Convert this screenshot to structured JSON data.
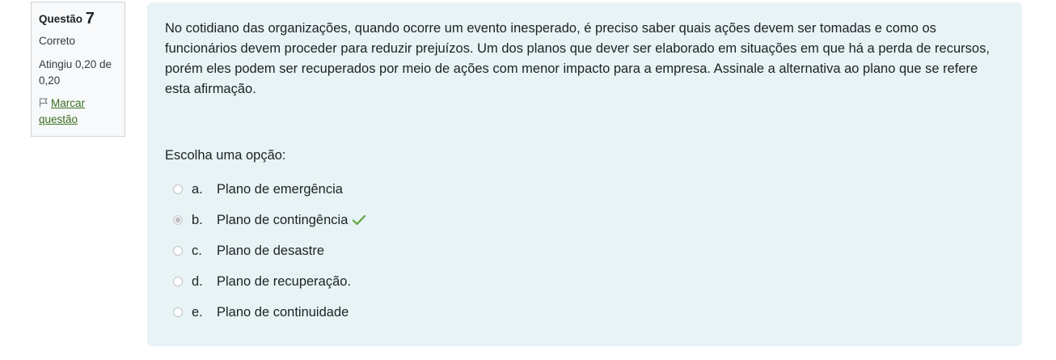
{
  "info": {
    "question_label": "Questão",
    "question_number": "7",
    "state": "Correto",
    "grade": "Atingiu 0,20 de 0,20",
    "flag_label": "Marcar questão"
  },
  "question": {
    "text": "No cotidiano das organizações, quando ocorre um evento inesperado, é preciso saber quais ações devem ser tomadas e como os funcionários devem proceder para reduzir prejuízos. Um dos planos que dever ser elaborado em situações em que há a perda de recursos, porém eles podem ser recuperados por meio de ações com menor impacto para a empresa. Assinale a alternativa ao plano que se refere esta afirmação.",
    "prompt": "Escolha uma opção:",
    "answers": [
      {
        "letter": "a.",
        "label": "Plano de emergência"
      },
      {
        "letter": "b.",
        "label": "Plano de contingência"
      },
      {
        "letter": "c.",
        "label": "Plano de desastre"
      },
      {
        "letter": "d.",
        "label": "Plano de recuperação."
      },
      {
        "letter": "e.",
        "label": "Plano de continuidade"
      }
    ],
    "selected_index": 1
  },
  "colors": {
    "content_bg": "#e7f3f5",
    "info_bg": "#f8f9fa",
    "link": "#3b6e22",
    "correct": "#5ea33e"
  },
  "icons": {
    "flag": "flag-icon",
    "correct": "check-icon"
  }
}
